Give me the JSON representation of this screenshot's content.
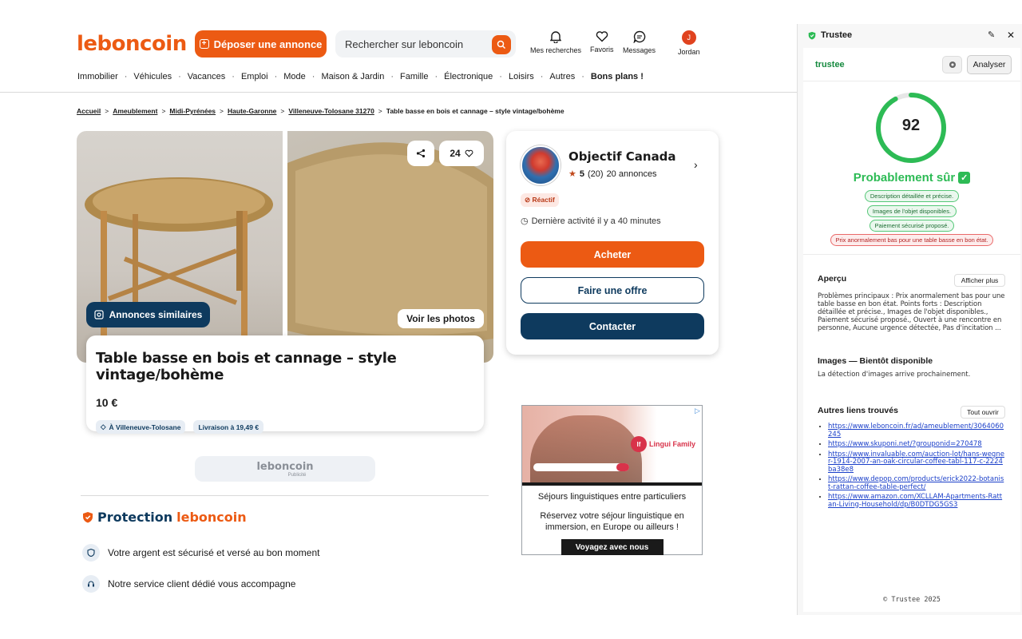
{
  "header": {
    "logo": "leboncoin",
    "post_label": "Déposer une annonce",
    "search_placeholder": "Rechercher sur leboncoin",
    "items": [
      {
        "label": "Mes recherches",
        "icon": "bell-icon"
      },
      {
        "label": "Favoris",
        "icon": "heart-icon"
      },
      {
        "label": "Messages",
        "icon": "chat-icon"
      },
      {
        "label": "Jordan",
        "avatar_letter": "J"
      }
    ]
  },
  "nav": [
    "Immobilier",
    "Véhicules",
    "Vacances",
    "Emploi",
    "Mode",
    "Maison & Jardin",
    "Famille",
    "Électronique",
    "Loisirs",
    "Autres",
    "Bons plans !"
  ],
  "breadcrumb": {
    "links": [
      "Accueil",
      "Ameublement",
      "Midi-Pyrénées",
      "Haute-Garonne",
      "Villeneuve-Tolosane 31270"
    ],
    "current": "Table basse en bois et cannage – style vintage/bohème"
  },
  "gallery": {
    "fav_count": "24",
    "similar_label": "Annonces similaires",
    "photos_label": "Voir les photos"
  },
  "ad": {
    "title": "Table basse en bois et cannage – style vintage/bohème",
    "price": "10 €",
    "location": "À Villeneuve-Tolosane",
    "delivery": "Livraison à 19,49 €"
  },
  "pub": {
    "logo": "leboncoin",
    "label": "Publicité"
  },
  "protection": {
    "title_prefix": "Protection",
    "title_brand": "leboncoin",
    "items": [
      "Votre argent est sécurisé et versé au bon moment",
      "Notre service client dédié vous accompagne"
    ]
  },
  "seller": {
    "name": "Objectif Canada",
    "rating": "5",
    "reviews": "(20)",
    "ads_count": "20 annonces",
    "badge": "Réactif",
    "last_activity": "Dernière activité il y a 40 minutes",
    "buy_label": "Acheter",
    "offer_label": "Faire une offre",
    "contact_label": "Contacter"
  },
  "banner": {
    "brand": "Lingui Family",
    "caption": "Séjours linguistiques entre particuliers",
    "text": "Réservez votre séjour linguistique en immersion, en Europe ou ailleurs !",
    "cta": "Voyagez avec nous"
  },
  "trustee": {
    "window_title": "Trustee",
    "logo": "trustee",
    "analyze_label": "Analyser",
    "score": 92,
    "score_text": "92",
    "verdict": "Probablement sûr",
    "positives": [
      "Description détaillée et précise.",
      "Images de l'objet disponibles.",
      "Paiement sécurisé proposé."
    ],
    "negatives": [
      "Prix anormalement bas pour une table basse en bon état."
    ],
    "overview_title": "Aperçu",
    "show_more": "Afficher plus",
    "overview_text": "Problèmes principaux : Prix anormalement bas pour une table basse en bon état. Points forts : Description détaillée et précise., Images de l'objet disponibles., Paiement sécurisé proposé., Ouvert à une rencontre en personne, Aucune urgence détectée, Pas d'incitation ...",
    "images_title": "Images — Bientôt disponible",
    "images_text": "La détection d'images arrive prochainement.",
    "links_title": "Autres liens trouvés",
    "open_all": "Tout ouvrir",
    "links": [
      "https://www.leboncoin.fr/ad/ameublement/3064060245",
      "https://www.skuponi.net/?grouponid=270478",
      "https://www.invaluable.com/auction-lot/hans-wegner-1914-2007-an-oak-circular-coffee-tabl-117-c-2224ba38e8",
      "https://www.depop.com/products/erick2022-botanist-rattan-coffee-table-perfect/",
      "https://www.amazon.com/XCLLAM-Apartments-Rattan-Living-Household/dp/B0DTDG5GS3"
    ],
    "footer": "© Trustee 2025"
  },
  "colors": {
    "brand_orange": "#ec5a13",
    "navy": "#0e3a5e",
    "trust_green": "#2dbb55"
  }
}
